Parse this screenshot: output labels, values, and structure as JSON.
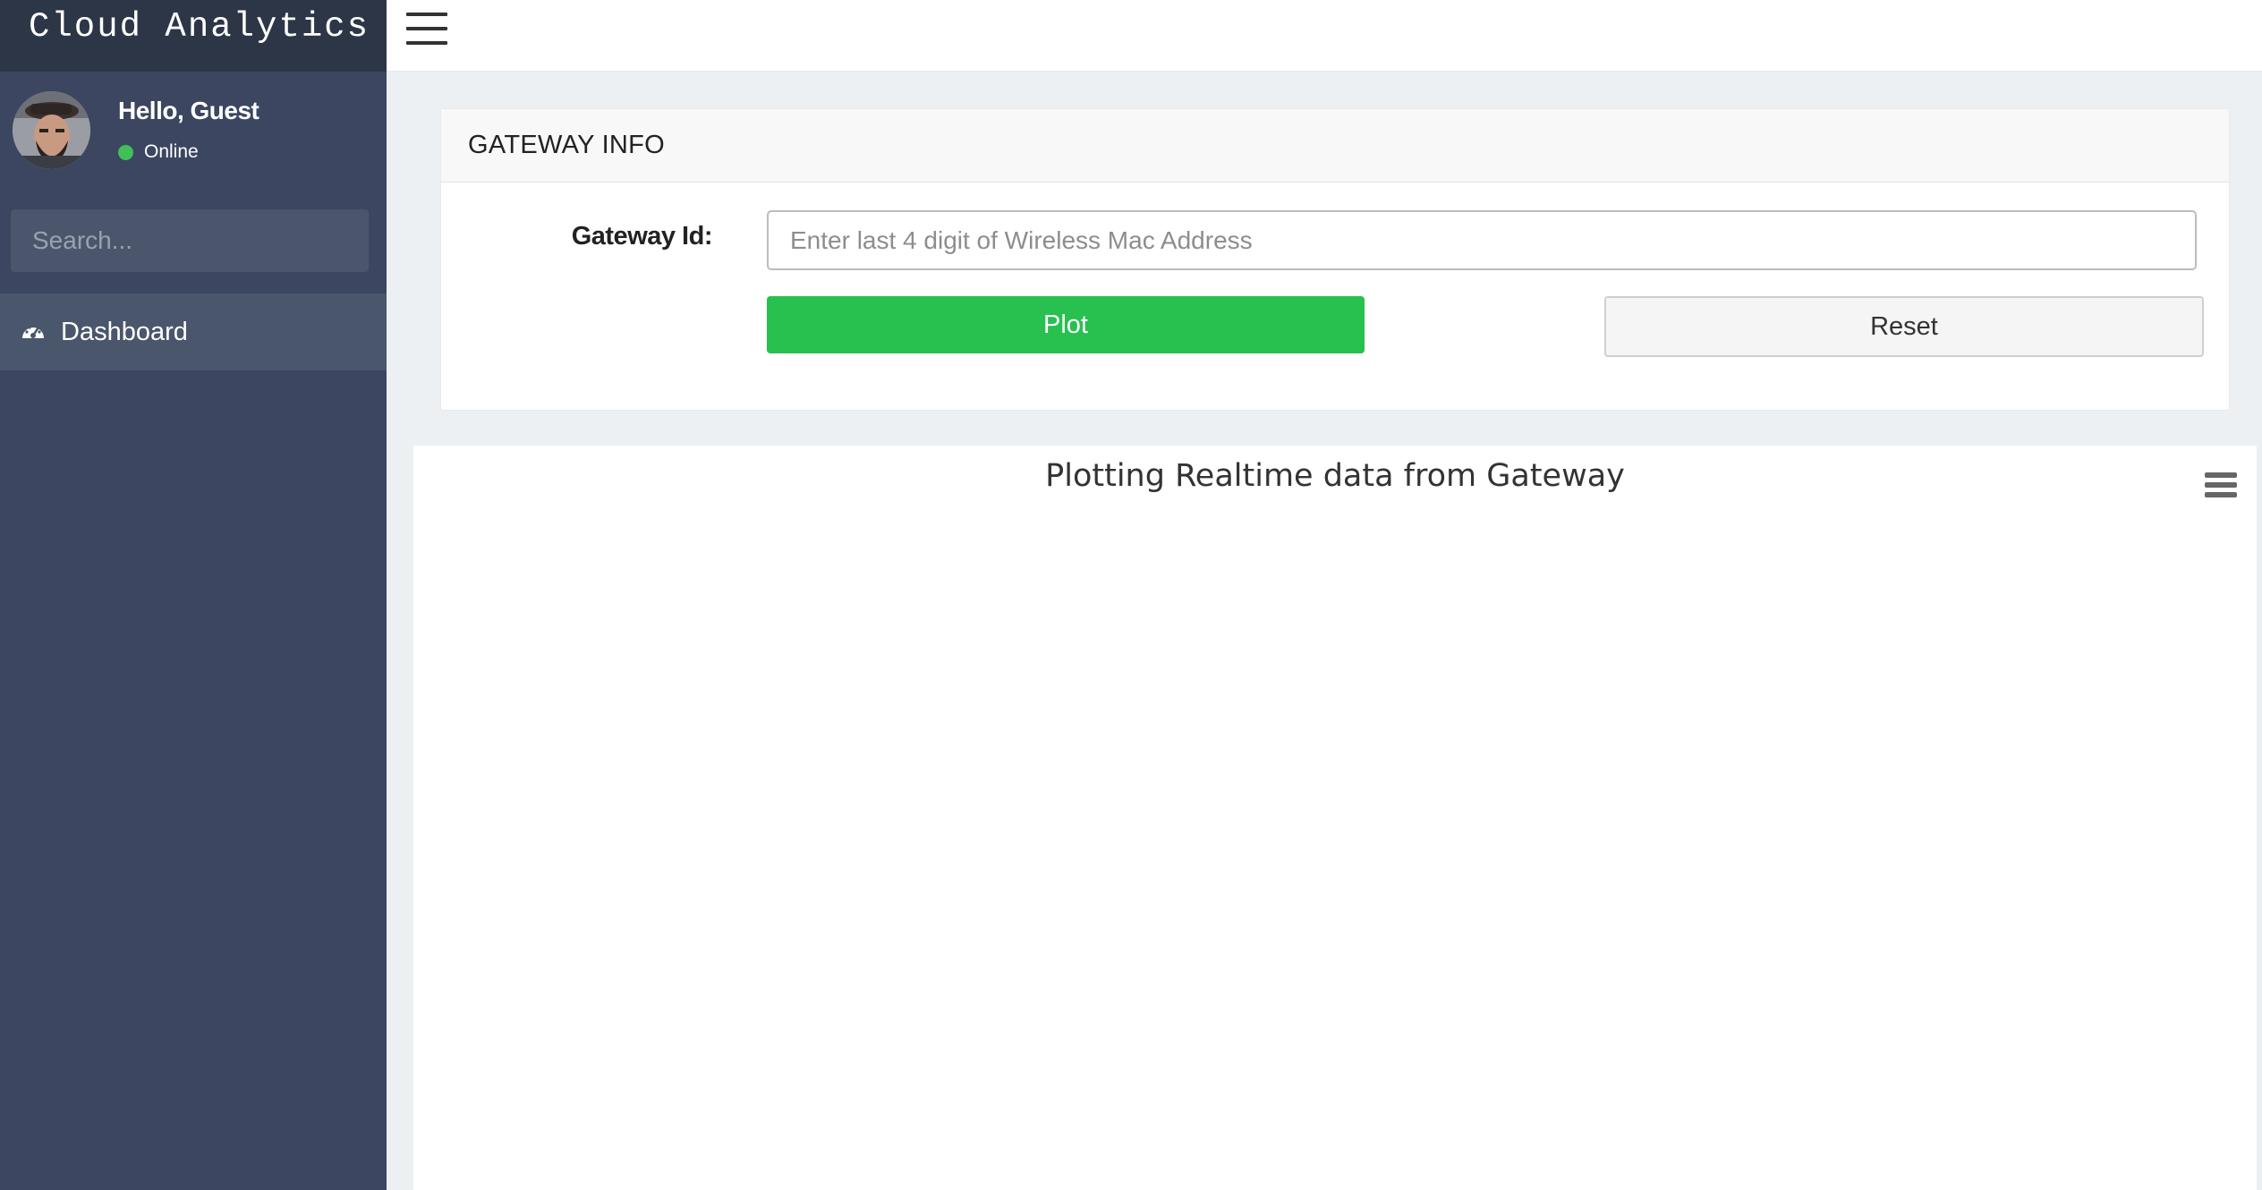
{
  "app": {
    "brand": "Cloud Analytics"
  },
  "user": {
    "greeting": "Hello, Guest",
    "status": "Online",
    "status_color": "#3fc05a",
    "avatar_icon": "user-avatar"
  },
  "search": {
    "placeholder": "Search...",
    "icon": "search-icon"
  },
  "sidebar": {
    "items": [
      {
        "label": "Dashboard",
        "icon": "dashboard-gauge-icon"
      }
    ]
  },
  "topbar": {
    "menu_icon": "hamburger-icon"
  },
  "gateway_panel": {
    "heading": "GATEWAY INFO",
    "gateway_label": "Gateway Id:",
    "gateway_placeholder": "Enter last 4 digit of Wireless Mac Address",
    "gateway_value": "",
    "plot_label": "Plot",
    "reset_label": "Reset",
    "plot_color": "#28c04f"
  },
  "chart": {
    "title": "Plotting Realtime data from Gateway",
    "menu_icon": "chart-context-menu-icon"
  },
  "chart_data": {
    "type": "line",
    "title": "Plotting Realtime data from Gateway",
    "series": []
  },
  "colors": {
    "sidebar_bg": "#3c4660",
    "brand_bg": "#2c3647",
    "active_item_bg": "#4a566b",
    "content_bg": "#edf0f2"
  }
}
